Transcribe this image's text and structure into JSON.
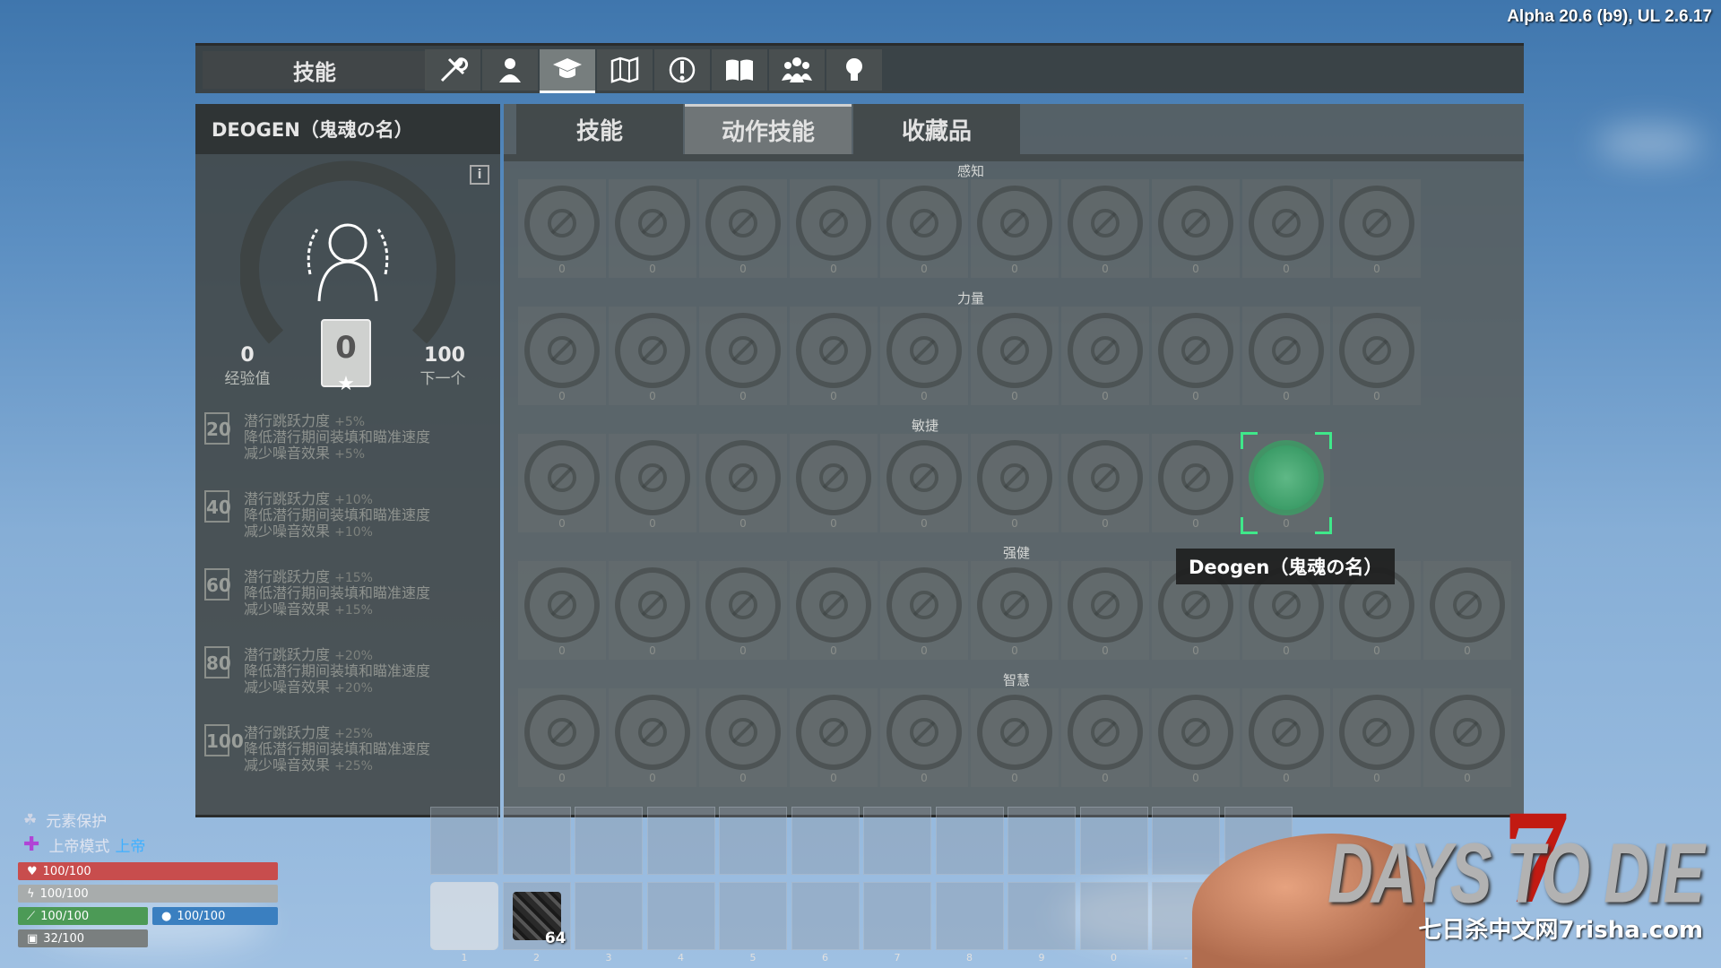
{
  "version": "Alpha 20.6 (b9), UL 2.6.17",
  "topbar": {
    "title": "技能",
    "tabs": [
      {
        "icon": "crafting-tools-icon"
      },
      {
        "icon": "character-icon"
      },
      {
        "icon": "skills-graduation-icon",
        "active": true
      },
      {
        "icon": "map-icon"
      },
      {
        "icon": "quests-icon"
      },
      {
        "icon": "journal-book-icon"
      },
      {
        "icon": "players-group-icon"
      },
      {
        "icon": "lightbulb-tips-icon"
      }
    ]
  },
  "left": {
    "header": "DEOGEN（鬼魂の名）",
    "info_icon": "i",
    "xp_current": "0",
    "xp_label": "经验值",
    "level": "0",
    "xp_next": "100",
    "xp_next_label": "下一个",
    "levels": [
      {
        "level": "20",
        "line1": "潜行跳跃力度",
        "b1": "+5%",
        "line2": "降低潜行期间装填和瞄准速度",
        "line3": "减少噪音效果",
        "b3": "+5%"
      },
      {
        "level": "40",
        "line1": "潜行跳跃力度",
        "b1": "+10%",
        "line2": "降低潜行期间装填和瞄准速度",
        "line3": "减少噪音效果",
        "b3": "+10%"
      },
      {
        "level": "60",
        "line1": "潜行跳跃力度",
        "b1": "+15%",
        "line2": "降低潜行期间装填和瞄准速度",
        "line3": "减少噪音效果",
        "b3": "+15%"
      },
      {
        "level": "80",
        "line1": "潜行跳跃力度",
        "b1": "+20%",
        "line2": "降低潜行期间装填和瞄准速度",
        "line3": "减少噪音效果",
        "b3": "+20%"
      },
      {
        "level": "100",
        "line1": "潜行跳跃力度",
        "b1": "+25%",
        "line2": "降低潜行期间装填和瞄准速度",
        "line3": "减少噪音效果",
        "b3": "+25%"
      }
    ]
  },
  "main": {
    "tabs": [
      {
        "label": "技能",
        "active": false
      },
      {
        "label": "动作技能",
        "active": true
      },
      {
        "label": "收藏品",
        "active": false
      }
    ],
    "categories": [
      {
        "label": "感知",
        "count": 10,
        "icons": [
          "rifle-icon",
          "bow-icon",
          "spear-icon",
          "thief-icon",
          "meat-icon",
          "brain-icon",
          "zombie-icon",
          "skull-crossbones-icon",
          "explorer-icon",
          "explosion-icon"
        ],
        "value": "0"
      },
      {
        "label": "力量",
        "count": 10,
        "icons": [
          "muscle-arm-icon",
          "assault-rifle-icon",
          "club-icon",
          "sledgehammer-icon",
          "axe-icon",
          "shovel-icon",
          "pickaxe-icon",
          "vase-icon",
          "heart-icon",
          "soldier-icon"
        ],
        "value": "0"
      },
      {
        "label": "敏捷",
        "count": 9,
        "icons": [
          "pistol-icon",
          "knife-icon",
          "running-man-icon",
          "sneaking-man-icon",
          "ninja-mask-icon",
          "bush-icon",
          "parkour-icon",
          "hooded-figure-icon",
          "selected-skill-icon"
        ],
        "value": "0"
      },
      {
        "label": "强健",
        "count": 11,
        "icons": [
          "shotgun-icon",
          "brass-knuckles-icon",
          "sun-icon",
          "snowflake-icon",
          "crouching-man-icon",
          "medical-symbol-icon",
          "meditation-icon",
          "miner-icon",
          "worker-icon",
          "scavenger-icon",
          "survivor-icon"
        ],
        "value": "0"
      },
      {
        "label": "智慧",
        "count": 11,
        "icons": [
          "smg-icon",
          "stun-baton-icon",
          "handshake-icon",
          "builder-icon",
          "wrench-icon",
          "radiant-icon",
          "hearth-icon",
          "house-icon",
          "tools-icon",
          "turret-icon",
          "gas-mask-icon"
        ],
        "value": "0"
      }
    ],
    "tooltip": "Deogen（鬼魂の名）"
  },
  "hud": {
    "status1_icon": "elemental-shield-icon",
    "status1": "元素保护",
    "status2_icon": "plus-icon",
    "status2": "上帝模式",
    "status2_extra": "上帝",
    "health": "100/100",
    "stamina": "100/100",
    "food": "100/100",
    "water": "100/100",
    "armor": "32/100",
    "colors": {
      "health": "#c84d4d",
      "stamina": "#a8acac",
      "food": "#4c9a56",
      "water": "#3a7fc0",
      "armor": "#7a7f7f"
    }
  },
  "toolbelt": {
    "slot_numbers": [
      "1",
      "2",
      "3",
      "4",
      "5",
      "6",
      "7",
      "8",
      "9",
      "0",
      "-",
      "="
    ],
    "item_count": "64"
  },
  "logo": {
    "seven": "7",
    "brand": "DAYS TO DIE",
    "sub": "七日杀中文网7risha.com"
  }
}
